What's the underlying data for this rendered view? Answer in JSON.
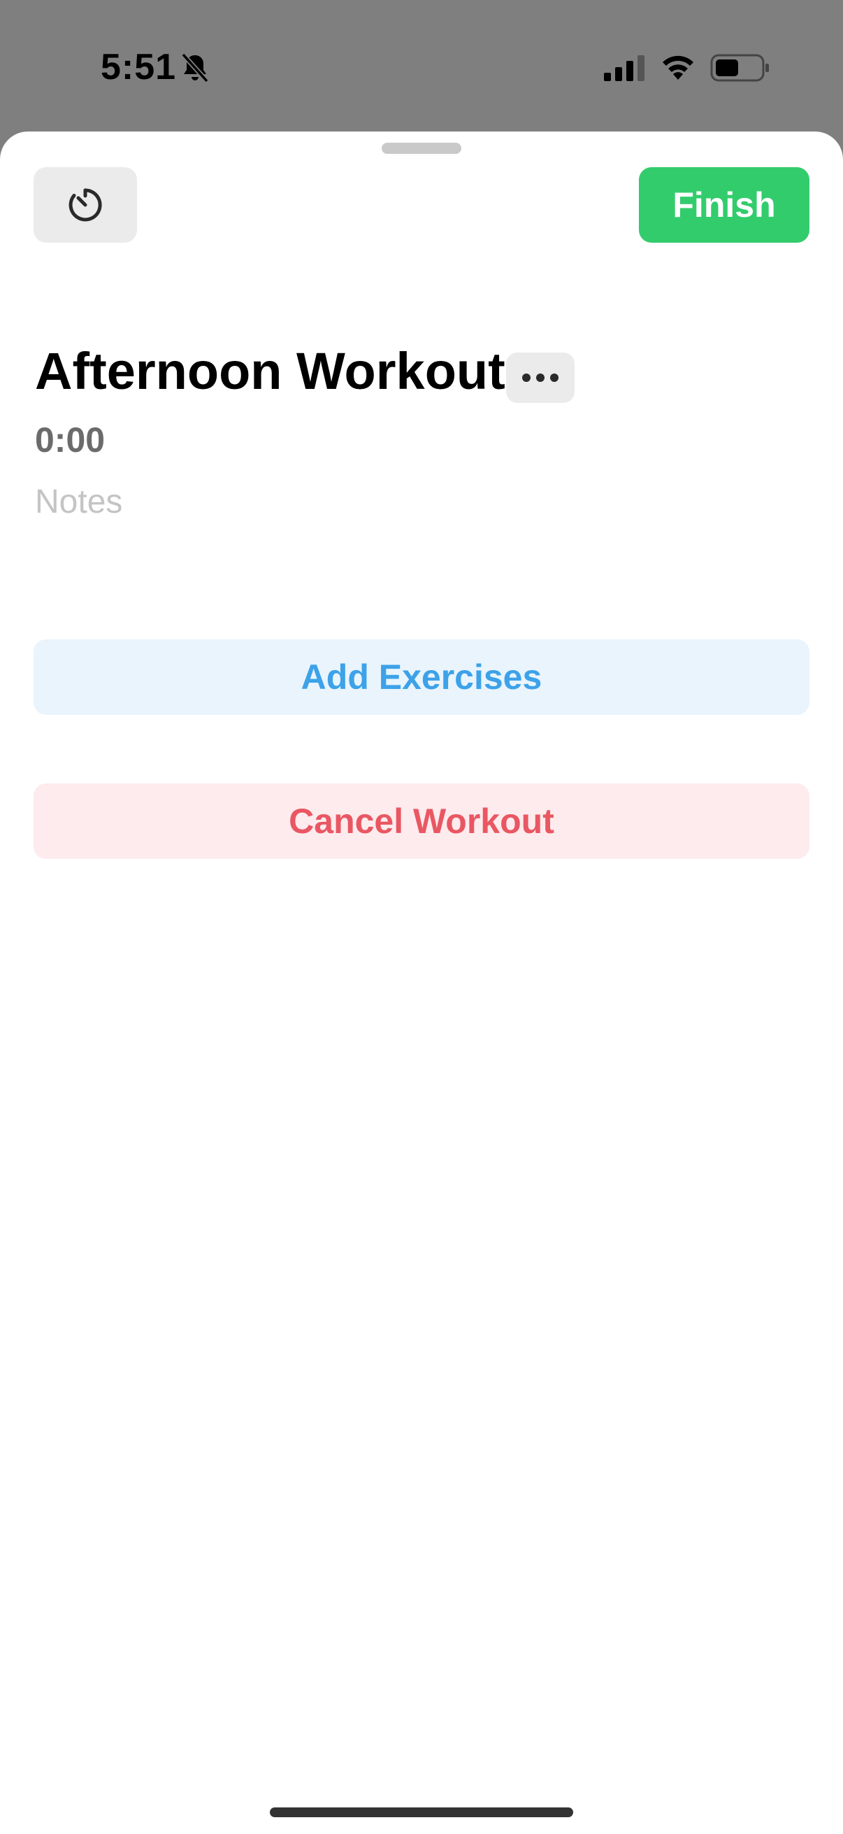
{
  "status_bar": {
    "time": "5:51",
    "icons": [
      "bell-slash-icon",
      "cellular-signal-icon",
      "wifi-icon",
      "battery-icon"
    ]
  },
  "toolbar": {
    "timer_icon": "timer-icon",
    "finish_label": "Finish"
  },
  "workout": {
    "title": "Afternoon Workout",
    "more_icon": "ellipsis-icon",
    "elapsed": "0:00",
    "notes_value": "",
    "notes_placeholder": "Notes"
  },
  "actions": {
    "add_exercises_label": "Add Exercises",
    "cancel_workout_label": "Cancel Workout"
  },
  "colors": {
    "finish_bg": "#33cc6d",
    "add_exercises_bg": "#e9f4fd",
    "add_exercises_text": "#3da2e8",
    "cancel_bg": "#fdebed",
    "cancel_text": "#e95763"
  }
}
